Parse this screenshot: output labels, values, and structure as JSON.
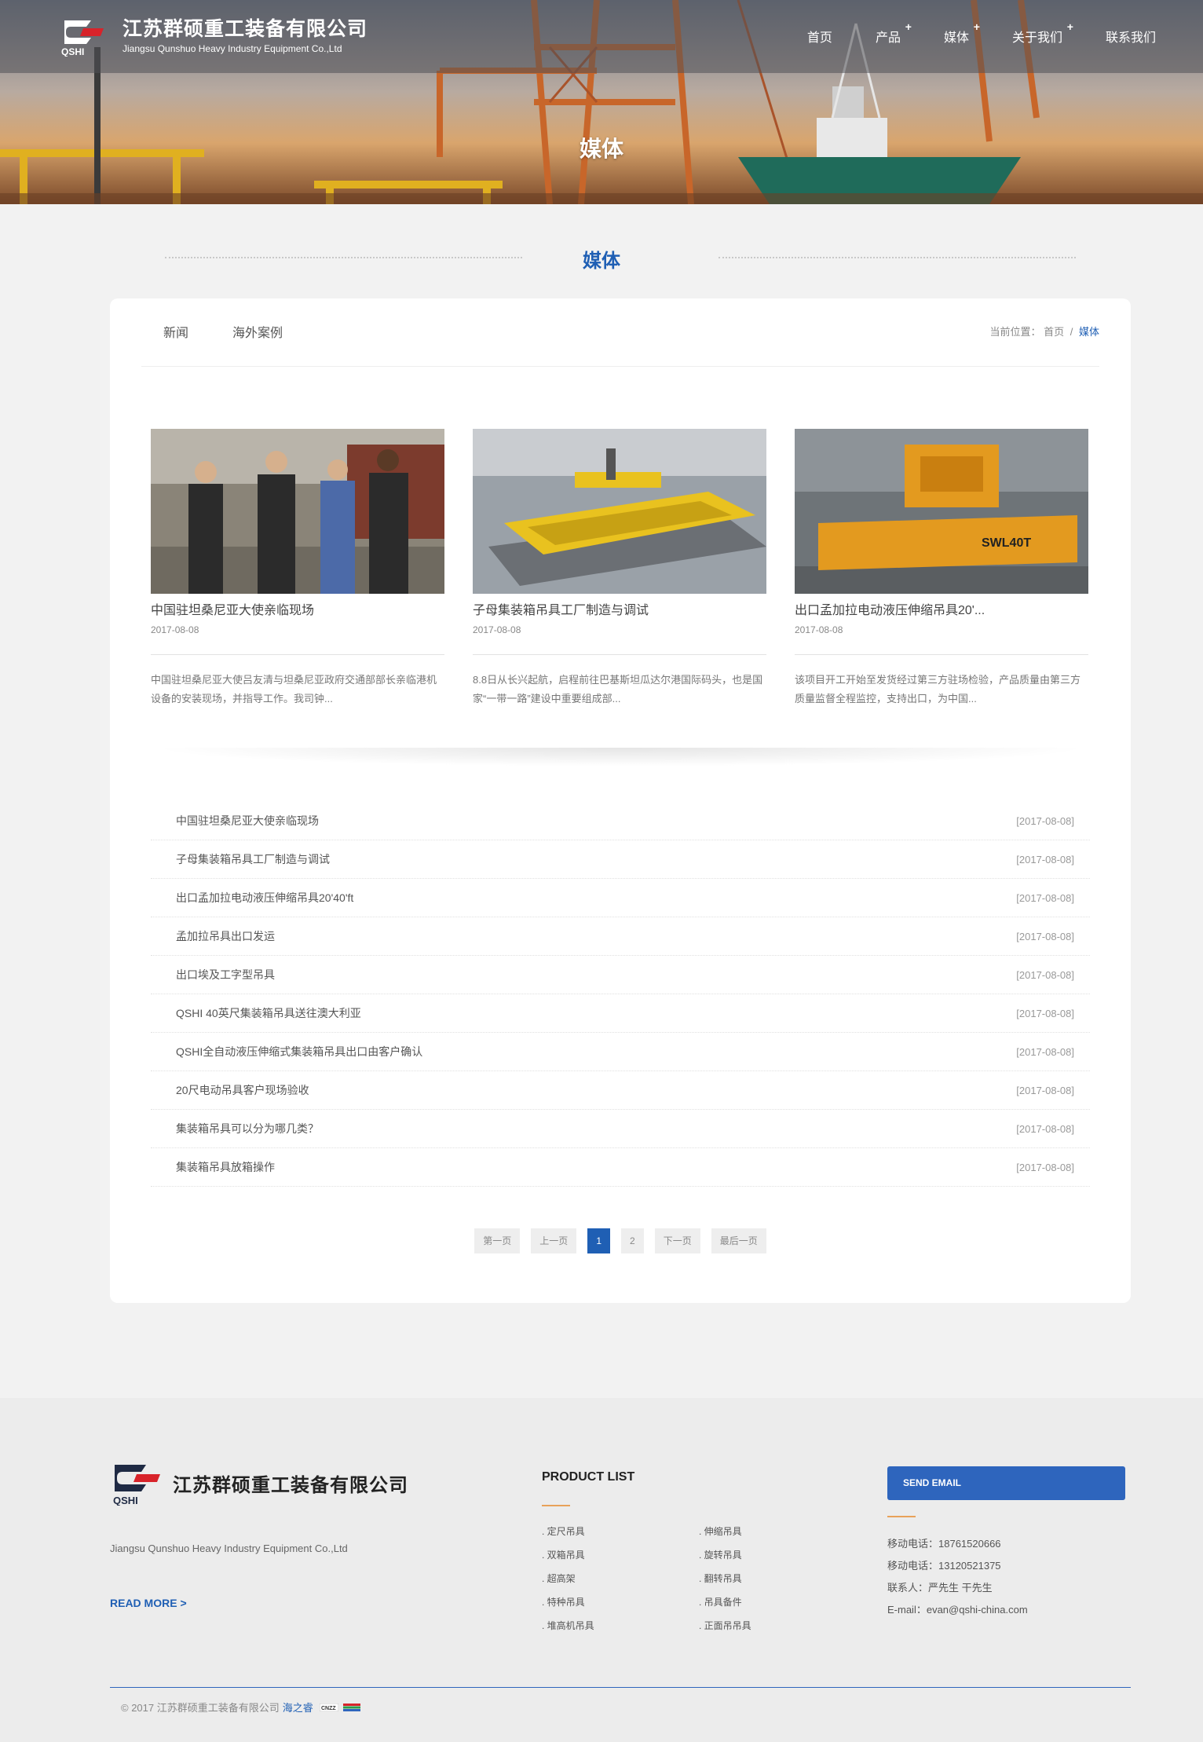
{
  "header": {
    "company_cn": "江苏群硕重工装备有限公司",
    "company_en": "Jiangsu Qunshuo Heavy Industry Equipment Co.,Ltd",
    "logo_text": "QSHI",
    "nav": [
      {
        "label": "首页",
        "has_sub": false
      },
      {
        "label": "产品",
        "has_sub": true
      },
      {
        "label": "媒体",
        "has_sub": true
      },
      {
        "label": "关于我们",
        "has_sub": true
      },
      {
        "label": "联系我们",
        "has_sub": false
      }
    ],
    "plus": "+",
    "banner_title": "媒体"
  },
  "section": {
    "title": "媒体"
  },
  "subnav": [
    {
      "label": "新闻"
    },
    {
      "label": "海外案例"
    }
  ],
  "breadcrumb": {
    "prefix": "当前位置：",
    "home": "首页",
    "sep": "/",
    "current": "媒体"
  },
  "features": [
    {
      "title": "中国驻坦桑尼亚大使亲临现场",
      "date": "2017-08-08",
      "desc": "中国驻坦桑尼亚大使吕友清与坦桑尼亚政府交通部部长亲临港机设备的安装现场，并指导工作。我司钟..."
    },
    {
      "title": "子母集装箱吊具工厂制造与调试",
      "date": "2017-08-08",
      "desc": "8.8日从长兴起航，启程前往巴基斯坦瓜达尔港国际码头，也是国家“一带一路”建设中重要组成部..."
    },
    {
      "title": "出口孟加拉电动液压伸缩吊具20'...",
      "date": "2017-08-08",
      "desc": "该项目开工开始至发货经过第三方驻场检验，产品质量由第三方质量监督全程监控，支持出口，为中国..."
    }
  ],
  "feature_image_labels": {
    "spreader": "SWL40T"
  },
  "list": [
    {
      "title": "中国驻坦桑尼亚大使亲临现场",
      "date": "[2017-08-08]"
    },
    {
      "title": "子母集装箱吊具工厂制造与调试",
      "date": "[2017-08-08]"
    },
    {
      "title": "出口孟加拉电动液压伸缩吊具20'40'ft",
      "date": "[2017-08-08]"
    },
    {
      "title": "孟加拉吊具出口发运",
      "date": "[2017-08-08]"
    },
    {
      "title": "出口埃及工字型吊具",
      "date": "[2017-08-08]"
    },
    {
      "title": "QSHI 40英尺集装箱吊具送往澳大利亚",
      "date": "[2017-08-08]"
    },
    {
      "title": "QSHI全自动液压伸缩式集装箱吊具出口由客户确认",
      "date": "[2017-08-08]"
    },
    {
      "title": "20尺电动吊具客户现场验收",
      "date": "[2017-08-08]"
    },
    {
      "title": "集装箱吊具可以分为哪几类？",
      "date": "[2017-08-08]"
    },
    {
      "title": "集装箱吊具放箱操作",
      "date": "[2017-08-08]"
    }
  ],
  "pagination": {
    "first": "第一页",
    "prev": "上一页",
    "pages": [
      "1",
      "2"
    ],
    "current": "1",
    "next": "下一页",
    "last": "最后一页"
  },
  "footer": {
    "company_cn": "江苏群硕重工装备有限公司",
    "logo_text": "QSHI",
    "company_en": "Jiangsu Qunshuo Heavy Industry Equipment Co.,Ltd",
    "read_more": "READ MORE >",
    "product_list_title": "PRODUCT LIST",
    "products": [
      ". 定尺吊具",
      ". 伸缩吊具",
      ". 双箱吊具",
      ". 旋转吊具",
      ". 超高架",
      ". 翻转吊具",
      ". 特种吊具",
      ". 吊具备件",
      ". 堆高机吊具",
      ". 正面吊吊具"
    ],
    "send_email": "SEND EMAIL",
    "contact": [
      "移动电话：18761520666",
      "移动电话：13120521375",
      "联系人：严先生 干先生",
      "E-mail：evan@qshi-china.com"
    ],
    "copyright": "© 2017 江苏群硕重工装备有限公司",
    "credit_link": "海之睿",
    "badge_cnzz": "CNZZ"
  },
  "colors": {
    "accent": "#1f5fb4",
    "button": "#2e65bd",
    "orange": "#e8a25a"
  },
  "icons": [
    "qshi-logo-icon",
    "plus-icon",
    "cnzz-badge-icon",
    "stats-badge-icon"
  ]
}
